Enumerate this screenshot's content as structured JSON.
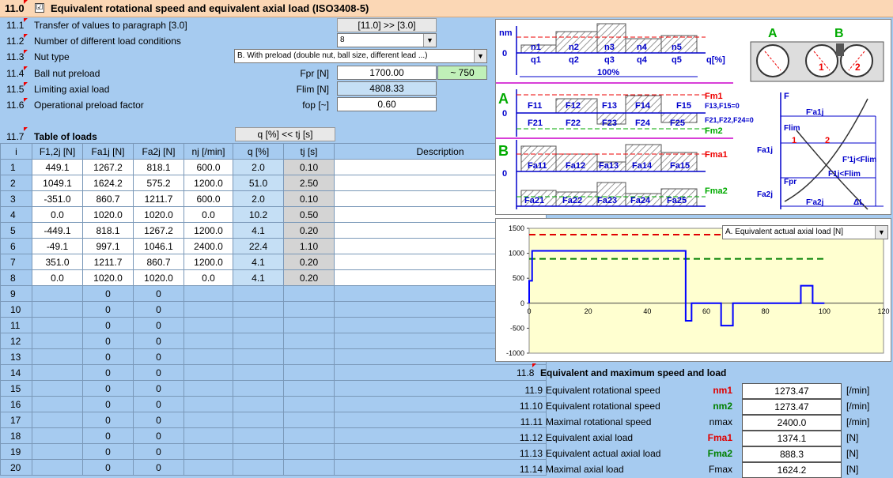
{
  "header": {
    "number": "11.0",
    "checkbox": "☑",
    "title": "Equivalent rotational speed and equivalent axial load (ISO3408-5)"
  },
  "params": [
    {
      "n": "11.1",
      "label": "Transfer of values to paragraph [3.0]",
      "button": "[11.0] >> [3.0]"
    },
    {
      "n": "11.2",
      "label": "Number of different load conditions",
      "value": "8"
    },
    {
      "n": "11.3",
      "label": "Nut type",
      "value": "B. With preload (double nut, ball size, different lead ...)"
    },
    {
      "n": "11.4",
      "label": "Ball nut preload",
      "unit": "Fpr [N]",
      "value": "1700.00",
      "extra": "~ 750"
    },
    {
      "n": "11.5",
      "label": "Limiting axial load",
      "unit": "Flim [N]",
      "value": "4808.33"
    },
    {
      "n": "11.6",
      "label": "Operational preload factor",
      "unit": "fop [~]",
      "value": "0.60"
    }
  ],
  "table": {
    "n": "11.7",
    "title": "Table of loads",
    "qbutton": "q [%] << tj [s]",
    "headers": [
      "i",
      "F1,2j [N]",
      "Fa1j [N]",
      "Fa2j [N]",
      "nj [/min]",
      "q [%]",
      "tj [s]",
      "Description"
    ],
    "rows": [
      [
        "1",
        "449.1",
        "1267.2",
        "818.1",
        "600.0",
        "2.0",
        "0.10",
        ""
      ],
      [
        "2",
        "1049.1",
        "1624.2",
        "575.2",
        "1200.0",
        "51.0",
        "2.50",
        ""
      ],
      [
        "3",
        "-351.0",
        "860.7",
        "1211.7",
        "600.0",
        "2.0",
        "0.10",
        ""
      ],
      [
        "4",
        "0.0",
        "1020.0",
        "1020.0",
        "0.0",
        "10.2",
        "0.50",
        ""
      ],
      [
        "5",
        "-449.1",
        "818.1",
        "1267.2",
        "1200.0",
        "4.1",
        "0.20",
        ""
      ],
      [
        "6",
        "-49.1",
        "997.1",
        "1046.1",
        "2400.0",
        "22.4",
        "1.10",
        ""
      ],
      [
        "7",
        "351.0",
        "1211.7",
        "860.7",
        "1200.0",
        "4.1",
        "0.20",
        ""
      ],
      [
        "8",
        "0.0",
        "1020.0",
        "1020.0",
        "0.0",
        "4.1",
        "0.20",
        ""
      ],
      [
        "9",
        "",
        "0",
        "0",
        "",
        "",
        "",
        ""
      ],
      [
        "10",
        "",
        "0",
        "0",
        "",
        "",
        "",
        ""
      ],
      [
        "11",
        "",
        "0",
        "0",
        "",
        "",
        "",
        ""
      ],
      [
        "12",
        "",
        "0",
        "0",
        "",
        "",
        "",
        ""
      ],
      [
        "13",
        "",
        "0",
        "0",
        "",
        "",
        "",
        ""
      ],
      [
        "14",
        "",
        "0",
        "0",
        "",
        "",
        "",
        ""
      ],
      [
        "15",
        "",
        "0",
        "0",
        "",
        "",
        "",
        ""
      ],
      [
        "16",
        "",
        "0",
        "0",
        "",
        "",
        "",
        ""
      ],
      [
        "17",
        "",
        "0",
        "0",
        "",
        "",
        "",
        ""
      ],
      [
        "18",
        "",
        "0",
        "0",
        "",
        "",
        "",
        ""
      ],
      [
        "19",
        "",
        "0",
        "0",
        "",
        "",
        "",
        ""
      ],
      [
        "20",
        "",
        "0",
        "0",
        "",
        "",
        "",
        ""
      ]
    ]
  },
  "diagram": {
    "y_nm": "nm",
    "zero": "0",
    "q_pct": "q[%]",
    "hundred": "100%",
    "n": [
      "n1",
      "n2",
      "n3",
      "n4",
      "n5"
    ],
    "q": [
      "q1",
      "q2",
      "q3",
      "q4",
      "q5"
    ],
    "A": "A",
    "B": "B",
    "F1": [
      "F11",
      "F12",
      "F13",
      "F14",
      "F15"
    ],
    "F2": [
      "F21",
      "F22",
      "F23",
      "F24",
      "F25"
    ],
    "Fm1": "Fm1",
    "Fm2": "Fm2",
    "Fma1": "Fma1",
    "Fma2": "Fma2",
    "Fa1": [
      "Fa11",
      "Fa12",
      "Fa13",
      "Fa14",
      "Fa15"
    ],
    "Fa2": [
      "Fa21",
      "Fa22",
      "Fa23",
      "Fa24",
      "Fa25"
    ],
    "note1": "F13,F15=0",
    "note2": "F21,F22,F24=0",
    "right": {
      "F": "F",
      "Fpa1": "F'a1j",
      "Flim": "Flim",
      "Fa1": "Fa1j",
      "one": "1",
      "two": "2",
      "F1lt": "F'1j<Flim",
      "F1lt2": "F1j<Flim",
      "Fpr": "Fpr",
      "Fa2": "Fa2j",
      "Fpa2": "F'a2j",
      "dL": "ΔL"
    }
  },
  "chart_data": {
    "type": "line",
    "dropdown": "A. Equivalent actual axial load [N]",
    "xlim": [
      0,
      120
    ],
    "ylim": [
      -1000,
      1500
    ],
    "xticks": [
      0,
      20,
      40,
      60,
      80,
      100,
      120
    ],
    "yticks": [
      -1000,
      -500,
      0,
      500,
      1000,
      1500
    ],
    "series": [
      {
        "color": "#0000ff",
        "x": [
          0,
          0,
          2,
          2,
          53,
          53,
          55,
          55,
          65,
          55,
          57,
          57,
          59,
          59,
          65,
          65,
          69,
          69,
          73,
          73,
          83,
          83,
          92,
          92,
          96,
          96,
          100
        ],
        "y": [
          0,
          449,
          449,
          1049,
          1049,
          1049,
          1049,
          -351,
          -351,
          -351,
          -351,
          0,
          0,
          0,
          0,
          -449,
          -449,
          -49,
          -49,
          0,
          0,
          0,
          0,
          351,
          351,
          0,
          0
        ]
      }
    ],
    "lines": [
      {
        "color": "#e00000",
        "y": 1374.1
      },
      {
        "color": "#008000",
        "y": 888.3
      }
    ]
  },
  "results": {
    "n": "11.8",
    "title": "Equivalent and maximum speed and load",
    "rows": [
      {
        "n": "11.9",
        "label": "Equivalent rotational speed",
        "sym": "nm1",
        "color": "#e00000",
        "value": "1273.47",
        "unit": "[/min]"
      },
      {
        "n": "11.10",
        "label": "Equivalent rotational speed",
        "sym": "nm2",
        "color": "#008000",
        "value": "1273.47",
        "unit": "[/min]"
      },
      {
        "n": "11.11",
        "label": "Maximal rotational speed",
        "sym": "nmax",
        "color": "#000000",
        "value": "2400.0",
        "unit": "[/min]"
      },
      {
        "n": "11.12",
        "label": "Equivalent axial load",
        "sym": "Fma1",
        "color": "#e00000",
        "value": "1374.1",
        "unit": "[N]"
      },
      {
        "n": "11.13",
        "label": "Equivalent actual axial load",
        "sym": "Fma2",
        "color": "#008000",
        "value": "888.3",
        "unit": "[N]"
      },
      {
        "n": "11.14",
        "label": "Maximal axial load",
        "sym": "Fmax",
        "color": "#000000",
        "value": "1624.2",
        "unit": "[N]"
      }
    ]
  }
}
